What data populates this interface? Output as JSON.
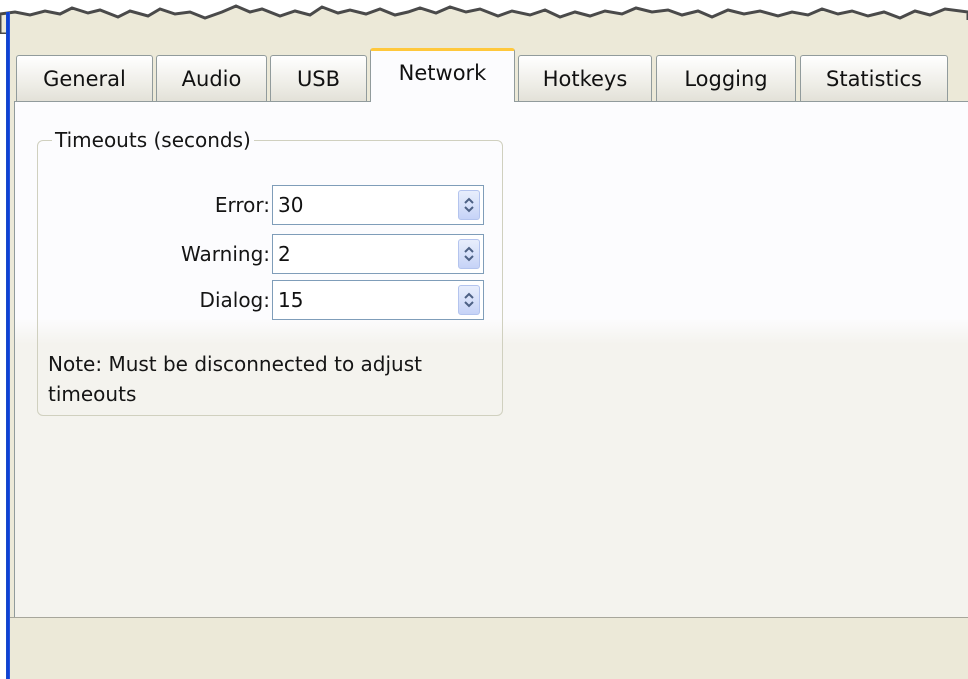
{
  "tabs": [
    {
      "label": "General"
    },
    {
      "label": "Audio"
    },
    {
      "label": "USB"
    },
    {
      "label": "Network",
      "selected": true
    },
    {
      "label": "Hotkeys"
    },
    {
      "label": "Logging"
    },
    {
      "label": "Statistics"
    }
  ],
  "timeouts": {
    "title": "Timeouts (seconds)",
    "error": {
      "label": "Error:",
      "value": "30"
    },
    "warning": {
      "label": "Warning:",
      "value": "2"
    },
    "dialog": {
      "label": "Dialog:",
      "value": "15"
    },
    "note": "Note: Must be disconnected to adjust timeouts"
  },
  "colors": {
    "selected_tab_highlight": "#ffc83c",
    "window_border": "#0a3bd8",
    "dialog_background": "#ece9d8"
  },
  "icons": {
    "spin_buttons": "up-down-arrows-icon"
  }
}
